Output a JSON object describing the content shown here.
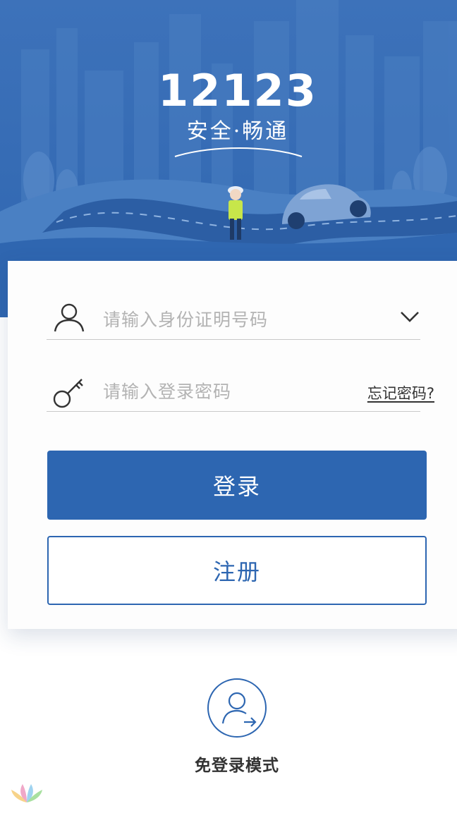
{
  "hero": {
    "brand_number": "12123",
    "slogan": "安全·畅通",
    "colors": {
      "sky": "#3a70b8",
      "hill": "#4d82c4",
      "road": "#2b5fa6"
    }
  },
  "login_form": {
    "id_placeholder": "请输入身份证明号码",
    "password_placeholder": "请输入登录密码",
    "forgot_password": "忘记密码?",
    "login_button": "登录",
    "register_button": "注册"
  },
  "guest_mode": {
    "label": "免登录模式",
    "icon": "user-arrow-icon"
  },
  "icons": {
    "user": "user-icon",
    "key": "key-icon",
    "dropdown": "chevron-down-icon"
  },
  "accent": "#2d66b1"
}
